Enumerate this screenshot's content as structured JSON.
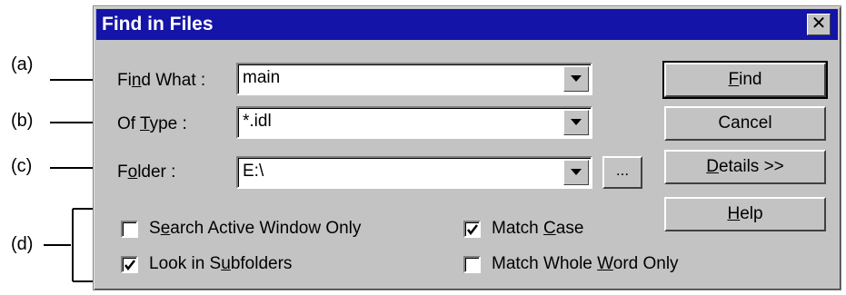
{
  "callouts": {
    "a": "(a)",
    "b": "(b)",
    "c": "(c)",
    "d": "(d)"
  },
  "window": {
    "title": "Find in Files",
    "close_glyph": "✕"
  },
  "fields": {
    "find_what": {
      "label_pre": "Fi",
      "label_ul": "n",
      "label_post": "d What :",
      "value": "main"
    },
    "of_type": {
      "label_pre": "Of ",
      "label_ul": "T",
      "label_post": "ype :",
      "value": "*.idl"
    },
    "folder": {
      "label_pre": "F",
      "label_ul": "o",
      "label_post": "lder :",
      "value": "E:\\"
    },
    "browse_label": "..."
  },
  "buttons": {
    "find": {
      "ul": "F",
      "rest": "ind"
    },
    "cancel": "Cancel",
    "details": {
      "ul": "D",
      "rest": "etails >>"
    },
    "help": {
      "ul": "H",
      "rest": "elp"
    }
  },
  "options": {
    "search_active": {
      "pre": "S",
      "ul": "e",
      "post": "arch Active Window Only",
      "checked": false
    },
    "subfolders": {
      "pre": "Look in S",
      "ul": "u",
      "post": "bfolders",
      "checked": true
    },
    "match_case": {
      "pre": "Match ",
      "ul": "C",
      "post": "ase",
      "checked": true
    },
    "whole_word": {
      "pre": "Match Whole ",
      "ul": "W",
      "post": "ord Only",
      "checked": false
    }
  },
  "icons": {
    "dropdown": "triangle-down-icon",
    "check": "checkmark-icon",
    "close": "close-icon",
    "arrow": "right-arrow-icon"
  }
}
